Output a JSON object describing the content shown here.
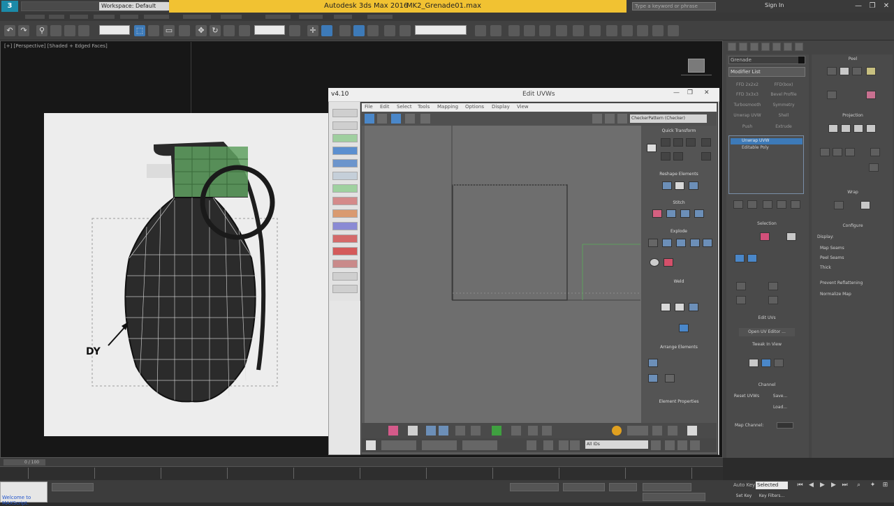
{
  "titlebar": {
    "logo": "3",
    "workspace": "Workspace: Default",
    "app_title": "Autodesk 3ds Max 2016",
    "file_name": "MK2_Grenade01.max",
    "search_placeholder": "Type a keyword or phrase",
    "sign_in": "Sign In",
    "minimize": "—",
    "maximize": "❐",
    "close": "✕"
  },
  "viewport": {
    "label": "[+] [Perspective] [Shaded + Edged Faces]",
    "reference_annotation": "DY"
  },
  "uvw_editor": {
    "version_label": "v4.10",
    "title": "Edit UVWs",
    "menu": [
      "File",
      "Edit",
      "Select",
      "Tools",
      "Mapping",
      "Options",
      "Display",
      "View"
    ],
    "map_dropdown": "CheckerPattern (Checker)",
    "panel_headers": [
      "Quick Transform",
      "Reshape Elements",
      "Stitch",
      "Explode",
      "Weld",
      "Arrange Elements",
      "Element Properties"
    ],
    "bottom_field": "All IDs"
  },
  "command_panel": {
    "object_name": "Grenade",
    "modifier_list": "Modifier List",
    "modifier_buttons": [
      "FFD 2x2x2",
      "FFD(box)",
      "FFD 3x3x3",
      "Bevel Profile",
      "Turbosmooth",
      "Symmetry",
      "Unwrap UVW",
      "Shell",
      "Push",
      "Extrude"
    ],
    "stack_items": [
      "Unwrap UVW",
      "Editable Poly"
    ],
    "rollouts": {
      "selection": "Selection",
      "edit_uvs": "Edit UVs",
      "open_uv_editor": "Open UV Editor ...",
      "tweak_in_view": "Tweak In View",
      "channel": "Channel",
      "reset_uvws": "Reset UVWs",
      "save": "Save...",
      "load": "Load...",
      "map_channel": "Map Channel:",
      "peel": "Peel",
      "projection": "Projection",
      "wrap": "Wrap",
      "configure": "Configure",
      "display": "Display:",
      "map_seams": "Map Seams",
      "peel_seams": "Peel Seams",
      "thick": "Thick",
      "prevent_reflattening": "Prevent Reflattening",
      "normalize_map": "Normalize Map"
    }
  },
  "timeline": {
    "slider": "0 / 100",
    "maxscript": "Welcome to MAXScript.",
    "auto_key": "Auto Key",
    "selected": "Selected",
    "set_key": "Set Key",
    "key_filters": "Key Filters..."
  },
  "colors": {
    "title_highlight": "#f1c232",
    "viewport_bg": "#171717",
    "uv_canvas": "#6e6e6e",
    "selection_blue": "#3d7ab8"
  }
}
